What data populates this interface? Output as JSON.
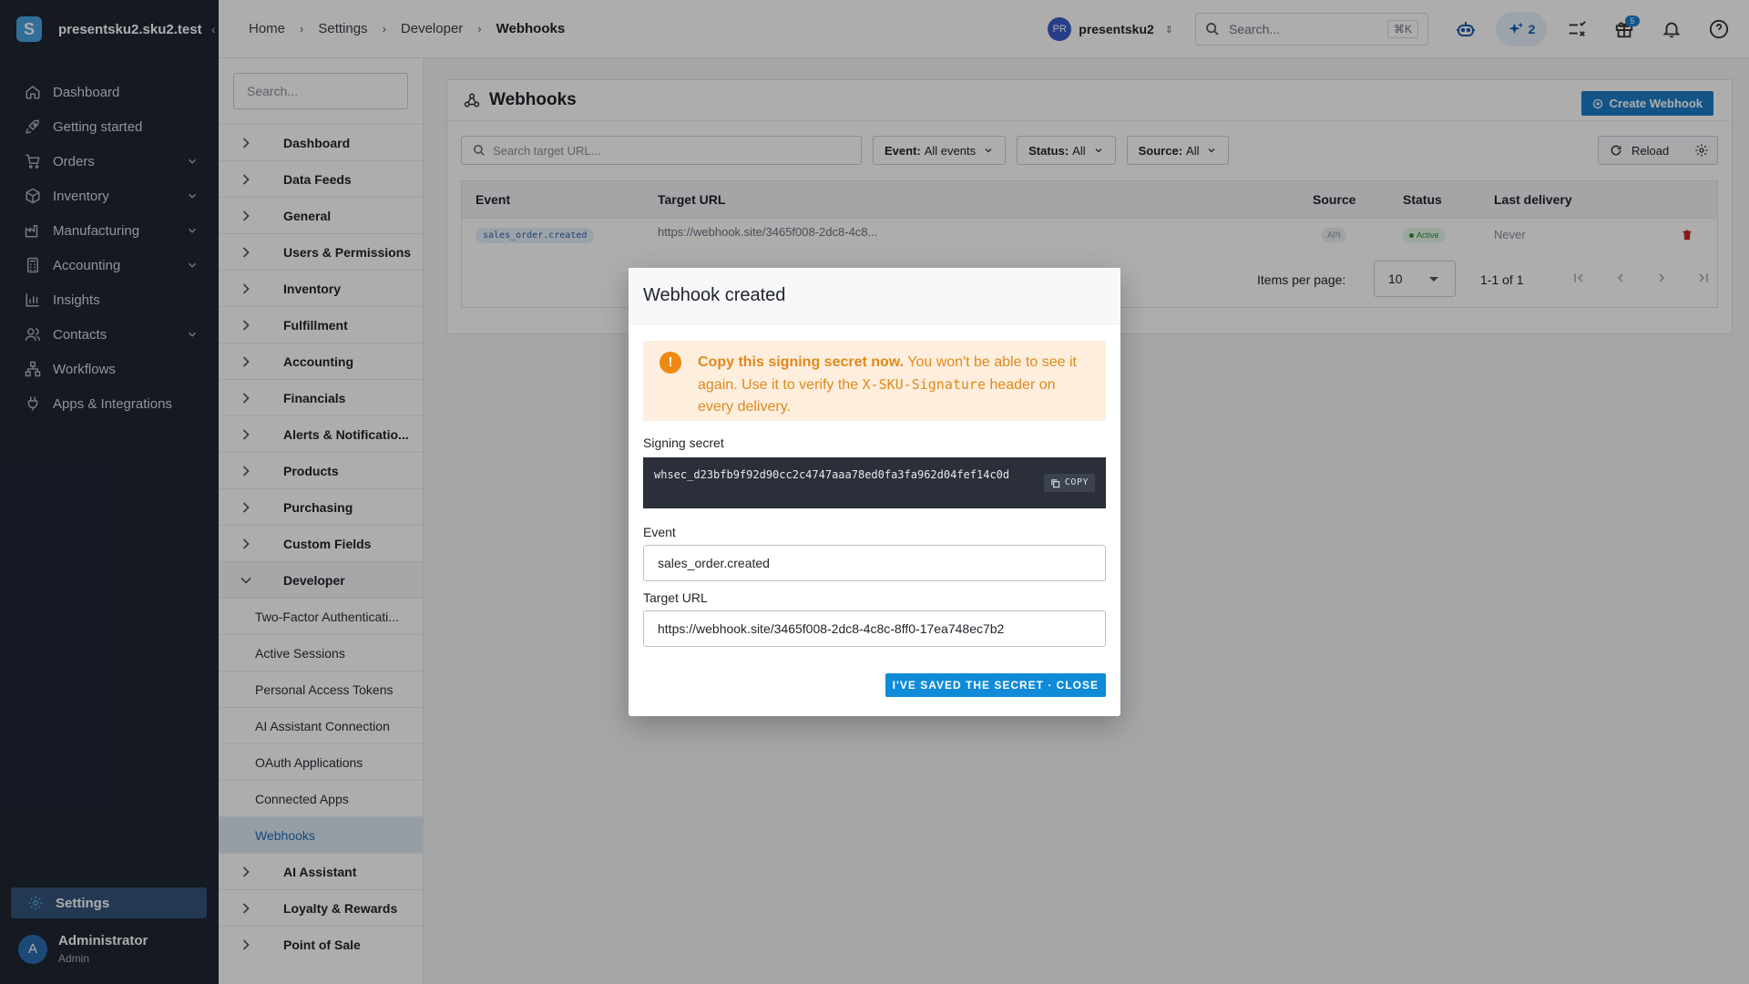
{
  "app": {
    "workspace": "presentsku2.sku2.test",
    "nav": [
      {
        "label": "Dashboard",
        "icon": "home-icon"
      },
      {
        "label": "Getting started",
        "icon": "rocket-icon"
      },
      {
        "label": "Orders",
        "icon": "cart-icon"
      },
      {
        "label": "Inventory",
        "icon": "box-icon"
      },
      {
        "label": "Manufacturing",
        "icon": "factory-icon"
      },
      {
        "label": "Accounting",
        "icon": "calculator-icon"
      },
      {
        "label": "Insights",
        "icon": "bar-chart-icon"
      },
      {
        "label": "Contacts",
        "icon": "users-icon"
      },
      {
        "label": "Workflows",
        "icon": "workflow-icon"
      },
      {
        "label": "Apps & Integrations",
        "icon": "plug-icon"
      }
    ],
    "settings_label": "Settings",
    "user": {
      "initial": "A",
      "name": "Administrator",
      "role": "Admin"
    }
  },
  "header": {
    "breadcrumb": [
      "Home",
      "Settings",
      "Developer",
      "Webhooks"
    ],
    "org": {
      "initials": "PR",
      "name": "presentsku2"
    },
    "search_placeholder": "Search...",
    "search_shortcut": "⌘K",
    "ai_count": "2",
    "gift_badge": "5"
  },
  "settings_nav": {
    "search_placeholder": "Search...",
    "sections_top": [
      "Dashboard",
      "Data Feeds",
      "General",
      "Users & Permissions",
      "Inventory",
      "Fulfillment",
      "Accounting",
      "Financials",
      "Alerts & Notificatio...",
      "Products",
      "Purchasing",
      "Custom Fields"
    ],
    "expanded": "Developer",
    "developer_items": [
      "Two-Factor Authenticati...",
      "Active Sessions",
      "Personal Access Tokens",
      "AI Assistant Connection",
      "OAuth Applications",
      "Connected Apps",
      "Webhooks"
    ],
    "active_item": "Webhooks",
    "sections_bottom": [
      "AI Assistant",
      "Loyalty & Rewards",
      "Point of Sale"
    ]
  },
  "webhooks": {
    "title": "Webhooks",
    "create_label": "Create Webhook",
    "url_search_placeholder": "Search target URL...",
    "filters": [
      {
        "key": "Event:",
        "value": "All events"
      },
      {
        "key": "Status:",
        "value": "All"
      },
      {
        "key": "Source:",
        "value": "All"
      }
    ],
    "reload_label": "Reload",
    "columns": {
      "event": "Event",
      "target": "Target URL",
      "source": "Source",
      "status": "Status",
      "last": "Last delivery"
    },
    "row": {
      "event": "sales_order.created",
      "target": "https://webhook.site/3465f008-2dc8-4c8...",
      "source": "API",
      "status": "Active",
      "last": "Never"
    },
    "pagination": {
      "items_per_page_label": "Items per page:",
      "items_per_page": "10",
      "range": "1-1 of 1"
    }
  },
  "dialog": {
    "title": "Webhook created",
    "warning_bold": "Copy this signing secret now.",
    "warning_a": " You won't be able to see it again. Use it to verify the ",
    "warning_code": "X-SKU-Signature",
    "warning_b": " header on every delivery.",
    "secret_label": "Signing secret",
    "secret": "whsec_d23bfb9f92d90cc2c4747aaa78ed0fa3fa962d04fef14c0d",
    "copy_label": "COPY",
    "event_label": "Event",
    "event_value": "sales_order.created",
    "url_label": "Target URL",
    "url_value": "https://webhook.site/3465f008-2dc8-4c8c-8ff0-17ea748ec7b2",
    "close_label": "I'VE SAVED THE SECRET · CLOSE"
  },
  "colors": {
    "accent": "#1c7cc7",
    "sidebar": "#1e2533",
    "warning": "#e0891b",
    "active": "#2e8b3d"
  }
}
